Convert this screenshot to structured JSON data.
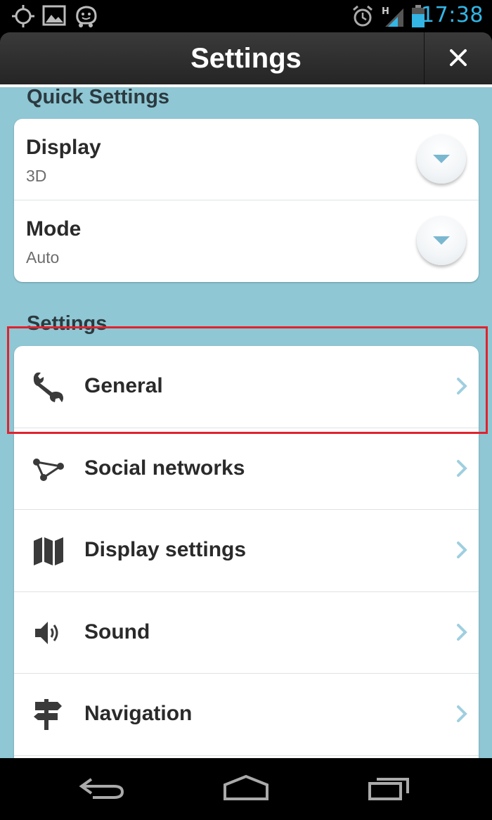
{
  "status_bar": {
    "time": "17:38",
    "left_icons": [
      "gps-icon",
      "gallery-icon",
      "waze-icon"
    ],
    "right_icons": [
      "alarm-icon",
      "signal-icon",
      "battery-icon"
    ],
    "network_type": "H"
  },
  "header": {
    "title": "Settings",
    "close_icon": "close-icon"
  },
  "quick_settings": {
    "title": "Quick Settings",
    "items": [
      {
        "label": "Display",
        "value": "3D"
      },
      {
        "label": "Mode",
        "value": "Auto"
      }
    ]
  },
  "settings": {
    "title": "Settings",
    "items": [
      {
        "label": "General",
        "icon": "wrench-icon"
      },
      {
        "label": "Social networks",
        "icon": "network-icon"
      },
      {
        "label": "Display settings",
        "icon": "map-icon"
      },
      {
        "label": "Sound",
        "icon": "speaker-icon"
      },
      {
        "label": "Navigation",
        "icon": "signpost-icon"
      }
    ]
  },
  "nav_bar": {
    "buttons": [
      "back-icon",
      "home-icon",
      "recents-icon"
    ]
  },
  "colors": {
    "accent": "#33b5e5",
    "background": "#8fc7d4",
    "highlight": "#e0232e"
  }
}
